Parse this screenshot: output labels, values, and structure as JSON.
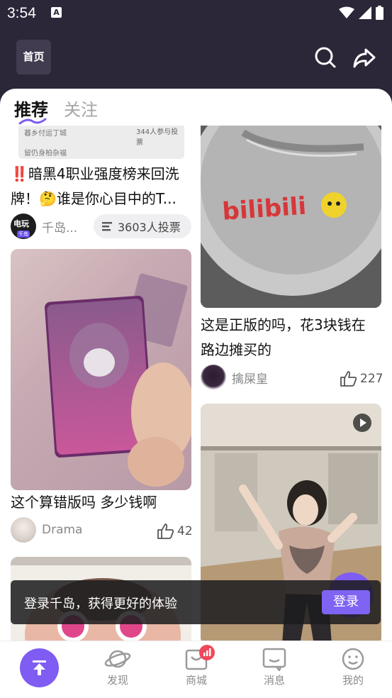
{
  "status_bar": {
    "time": "3:54",
    "notification_icon": "A"
  },
  "header": {
    "home_label": "首页"
  },
  "tabs": [
    {
      "label": "推荐",
      "active": true
    },
    {
      "label": "关注",
      "active": false
    }
  ],
  "left_column": {
    "card1": {
      "image_text_a": "暮乡付运丁城",
      "image_text_b": "344人参与投票",
      "image_text_c": "留仍身柏杂福",
      "title_line1": "‼️暗黑4职业强度榜来回洗",
      "title_line2": "牌！🤔谁是你心目中的T...",
      "avatar_label": "电玩",
      "avatar_badge": "千岛",
      "username": "千岛...",
      "vote_count": "3603人投票"
    },
    "card2": {
      "title": "这个算错版吗 多少钱啊",
      "username": "Drama",
      "likes": "42"
    }
  },
  "right_column": {
    "card1": {
      "image_brand": "bilibili",
      "title_line1": "这是正版的吗，花3块钱在",
      "title_line2": "路边摊买的",
      "username": "擒屎皇",
      "likes": "227"
    },
    "card2": {
      "type": "video"
    }
  },
  "toast": {
    "message": "登录千岛，获得更好的体验",
    "button": "登录"
  },
  "bottom_nav": [
    {
      "label": "发现"
    },
    {
      "label": "商城"
    },
    {
      "label": "消息"
    },
    {
      "label": "我的"
    }
  ],
  "colors": {
    "accent": "#7f5cf2",
    "header_bg": "#2b2638",
    "cart_badge": "#f0485a"
  }
}
